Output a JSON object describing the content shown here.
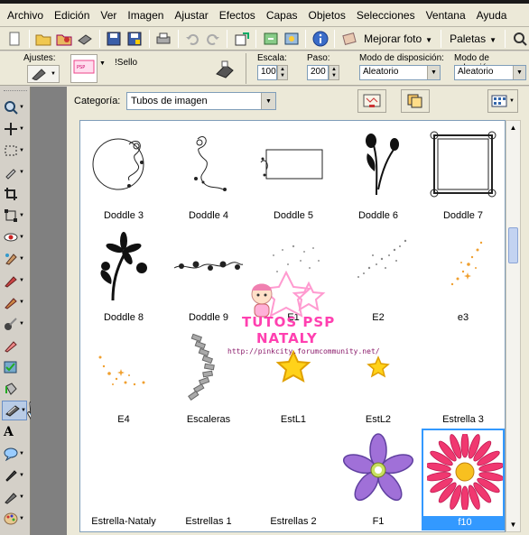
{
  "menubar": {
    "items": [
      "Archivo",
      "Edición",
      "Ver",
      "Imagen",
      "Ajustar",
      "Efectos",
      "Capas",
      "Objetos",
      "Selecciones",
      "Ventana",
      "Ayuda"
    ]
  },
  "toolbar": {
    "enhance_label": "Mejorar foto",
    "palettes_label": "Paletas"
  },
  "options": {
    "presets_label": "Ajustes:",
    "tube_name": "!Sello",
    "scale_label": "Escala:",
    "scale_value": "100",
    "step_label": "Paso:",
    "step_value": "200",
    "placement_label": "Modo de disposición:",
    "placement_value": "Aleatorio",
    "selection_label": "Modo de selección:",
    "selection_value": "Aleatorio"
  },
  "browser": {
    "category_label": "Categoría:",
    "category_value": "Tubos de imagen",
    "items": [
      {
        "name": "Doddle 3",
        "icon": "doodle-circle-frame"
      },
      {
        "name": "Doddle 4",
        "icon": "doodle-swirl"
      },
      {
        "name": "Doddle 5",
        "icon": "doodle-rect-frame"
      },
      {
        "name": "Doddle 6",
        "icon": "tulip-silhouette"
      },
      {
        "name": "Doddle 7",
        "icon": "ornate-square-frame"
      },
      {
        "name": "Doddle 8",
        "icon": "flower-silhouette"
      },
      {
        "name": "Doddle 9",
        "icon": "flower-border"
      },
      {
        "name": "E1",
        "icon": "sparkle-dots"
      },
      {
        "name": "E2",
        "icon": "sparkle-trail"
      },
      {
        "name": "e3",
        "icon": "orange-sparkles"
      },
      {
        "name": "E4",
        "icon": "orange-sparkle-arc"
      },
      {
        "name": "Escaleras",
        "icon": "stairs"
      },
      {
        "name": "EstL1",
        "icon": "yellow-star"
      },
      {
        "name": "EstL2",
        "icon": "small-yellow-star"
      },
      {
        "name": "Estrella 3",
        "icon": "blank"
      },
      {
        "name": "Estrella-Nataly",
        "icon": "blank"
      },
      {
        "name": "Estrellas 1",
        "icon": "blank"
      },
      {
        "name": "Estrellas 2",
        "icon": "blank"
      },
      {
        "name": "F1",
        "icon": "purple-flower"
      },
      {
        "name": "f10",
        "icon": "pink-daisy"
      }
    ],
    "selected_item": "f10"
  },
  "watermark": {
    "line1": "TUTOS PSP",
    "line2": "NATALY",
    "url": "http://pinkcity.forumcommunity.net/"
  }
}
